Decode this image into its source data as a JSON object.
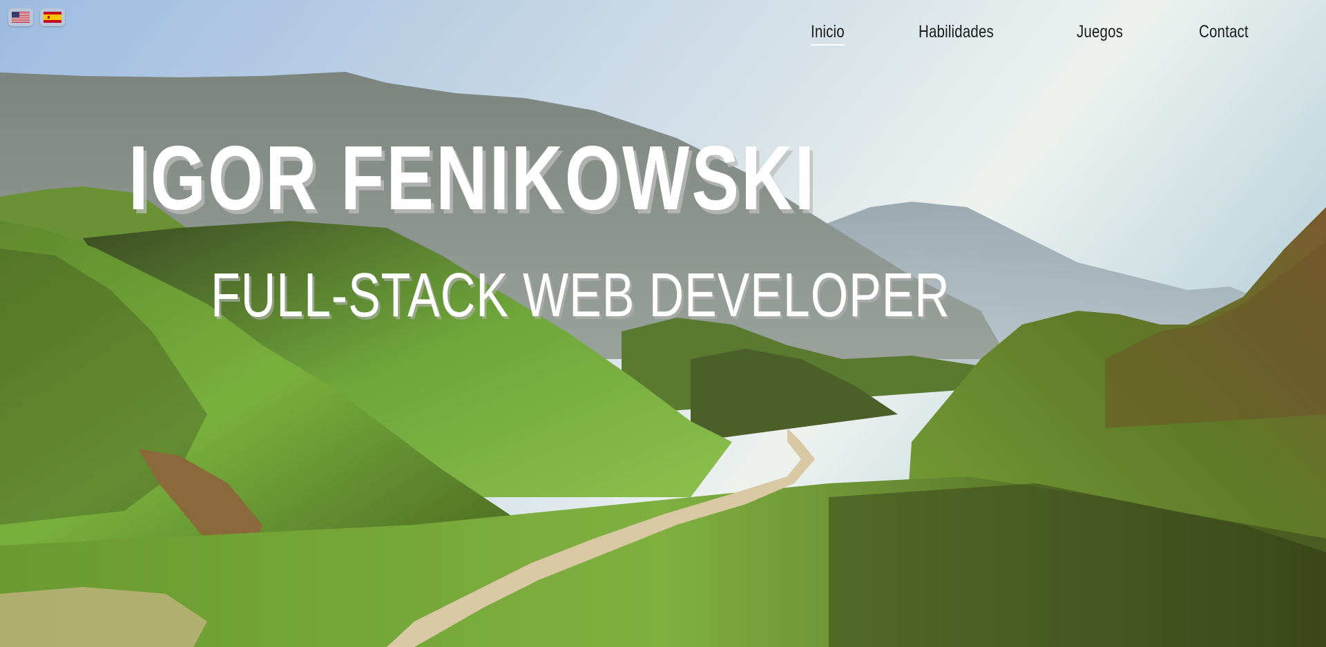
{
  "languages": [
    {
      "code": "en",
      "icon": "us-flag-icon"
    },
    {
      "code": "es",
      "icon": "spain-flag-icon"
    }
  ],
  "nav": {
    "items": [
      {
        "label": "Inicio",
        "active": true
      },
      {
        "label": "Habilidades",
        "active": false
      },
      {
        "label": "Juegos",
        "active": false
      },
      {
        "label": "Contact",
        "active": false
      }
    ]
  },
  "hero": {
    "name": "IGOR FENIKOWSKI",
    "role": "FULL-STACK WEB DEVELOPER"
  },
  "colors": {
    "sky_top": "#a9c4e0",
    "sky_haze": "#e8eef0",
    "mountain": "#6f7a78",
    "grass": "#6ea83a",
    "grass_dark": "#3a4a1e",
    "path": "#d9c8a4",
    "text": "#ffffff",
    "nav_text": "#1a1a1a"
  }
}
